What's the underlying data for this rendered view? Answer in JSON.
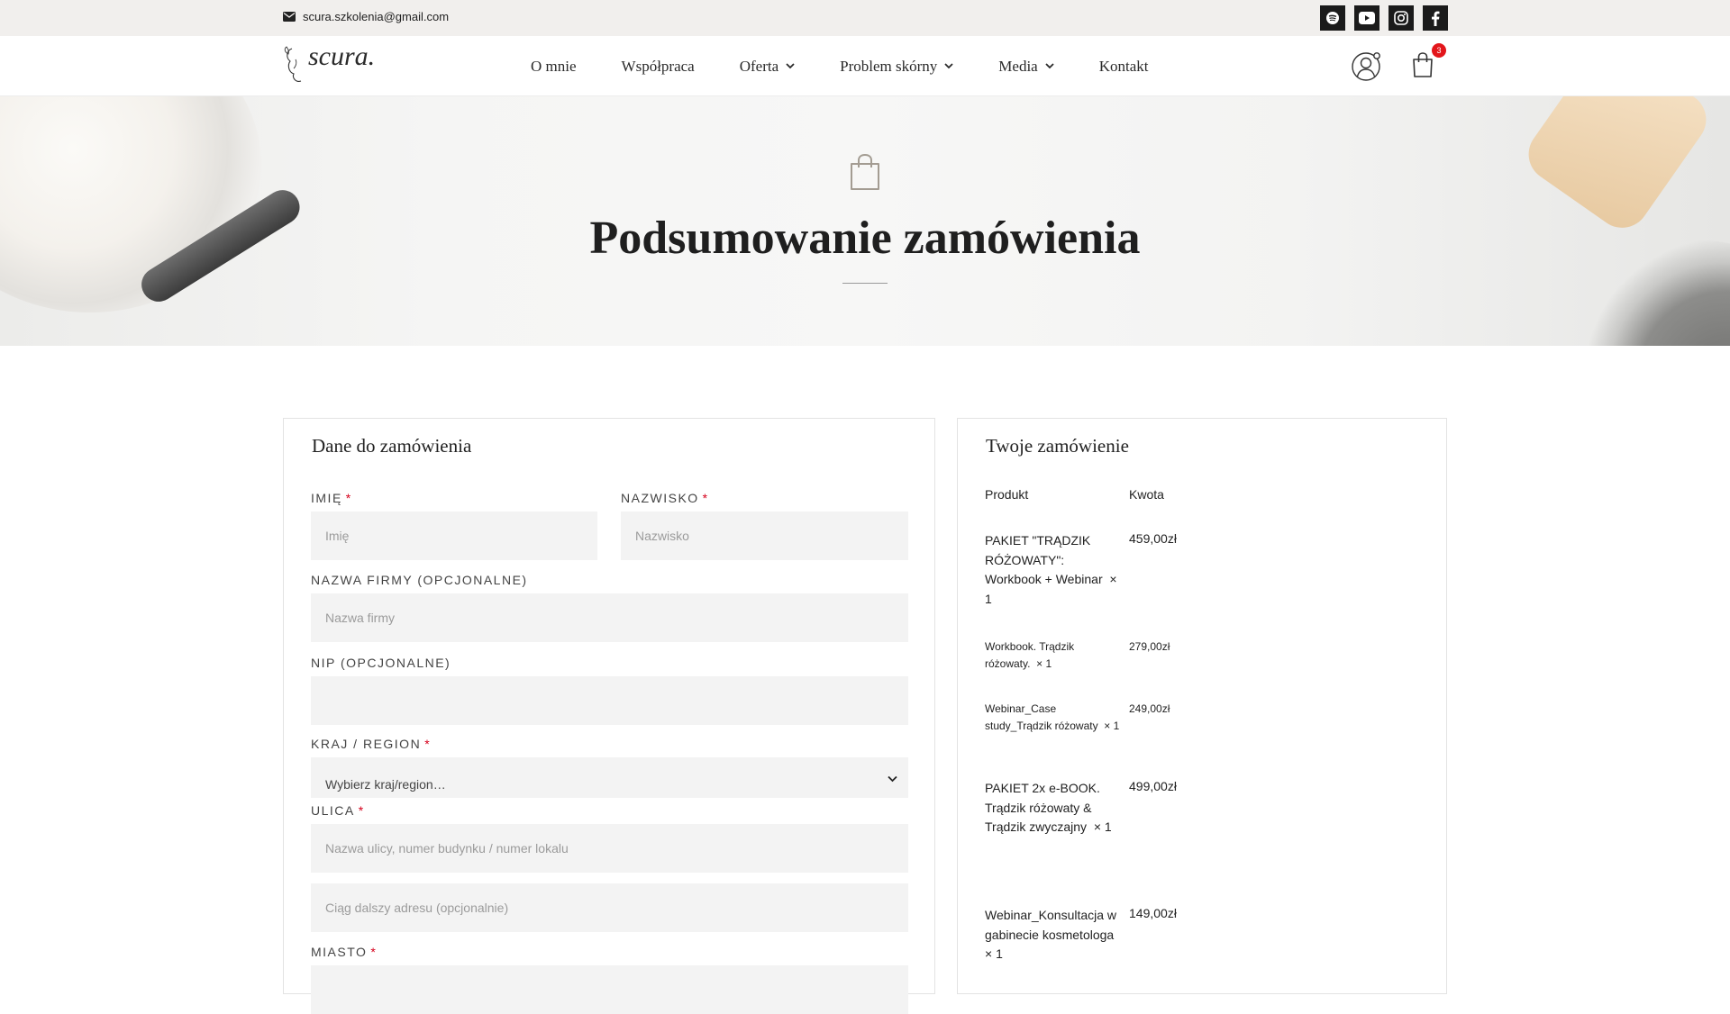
{
  "topbar": {
    "email": "scura.szkolenia@gmail.com",
    "socials": [
      "spotify-icon",
      "youtube-icon",
      "instagram-icon",
      "facebook-icon"
    ]
  },
  "header": {
    "logo_text": "scura.",
    "nav": [
      {
        "label": "O mnie",
        "has_dropdown": false
      },
      {
        "label": "Współpraca",
        "has_dropdown": false
      },
      {
        "label": "Oferta",
        "has_dropdown": true
      },
      {
        "label": "Problem skórny",
        "has_dropdown": true
      },
      {
        "label": "Media",
        "has_dropdown": true
      },
      {
        "label": "Kontakt",
        "has_dropdown": false
      }
    ],
    "cart_count": "3"
  },
  "hero": {
    "title": "Podsumowanie zamówienia"
  },
  "billing": {
    "title": "Dane do zamówienia",
    "first_name": {
      "label": "Imię",
      "placeholder": "Imię",
      "required": true
    },
    "last_name": {
      "label": "Nazwisko",
      "placeholder": "Nazwisko",
      "required": true
    },
    "company": {
      "label": "Nazwa firmy (opcjonalne)",
      "placeholder": "Nazwa firmy"
    },
    "nip": {
      "label": "NIP (opcjonalne)",
      "placeholder": ""
    },
    "country": {
      "label": "Kraj / Region",
      "value": "Wybierz kraj/region…",
      "required": true
    },
    "street": {
      "label": "Ulica",
      "placeholder": "Nazwa ulicy, numer budynku / numer lokalu",
      "placeholder2": "Ciąg dalszy adresu (opcjonalnie)",
      "required": true
    },
    "city": {
      "label": "Miasto",
      "required": true
    },
    "required_mark": "*"
  },
  "order": {
    "title": "Twoje zamówienie",
    "col_product": "Produkt",
    "col_amount": "Kwota",
    "items": [
      {
        "name": "PAKIET \"TRĄDZIK RÓŻOWATY\": Workbook + Webinar",
        "qty": "× 1",
        "amount": "459,00zł",
        "size": "big"
      },
      {
        "name": "Workbook. Trądzik różowaty.",
        "qty": "× 1",
        "amount": "279,00zł",
        "size": "small"
      },
      {
        "name": "Webinar_Case study_Trądzik różowaty",
        "qty": "× 1",
        "amount": "249,00zł",
        "size": "small"
      },
      {
        "name": "PAKIET 2x e-BOOK. Trądzik różowaty & Trądzik zwyczajny",
        "qty": "× 1",
        "amount": "499,00zł",
        "size": "big"
      },
      {
        "name": "Webinar_Konsultacja w gabinecie kosmetologa",
        "qty": "× 1",
        "amount": "149,00zł",
        "size": "big"
      }
    ]
  }
}
